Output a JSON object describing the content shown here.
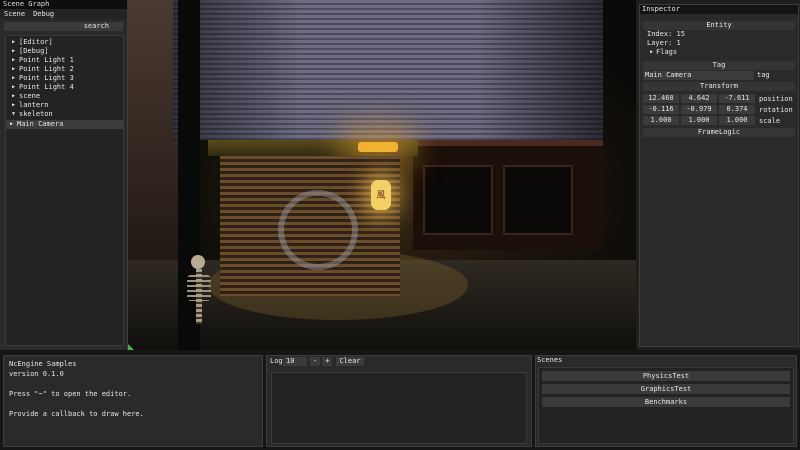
{
  "scene_graph": {
    "title": "Scene Graph",
    "menu": [
      "Scene",
      "Debug"
    ],
    "search_label": "search",
    "items": [
      {
        "label": "[Editor]",
        "expanded": false
      },
      {
        "label": "[Debug]",
        "expanded": false
      },
      {
        "label": "Point Light 1",
        "expanded": false
      },
      {
        "label": "Point Light 2",
        "expanded": false
      },
      {
        "label": "Point Light 3",
        "expanded": false
      },
      {
        "label": "Point Light 4",
        "expanded": false
      },
      {
        "label": "scene",
        "expanded": false
      },
      {
        "label": "lantern",
        "expanded": false
      },
      {
        "label": "skeleton",
        "expanded": true
      },
      {
        "label": "Main Camera",
        "expanded": false,
        "selected": true
      }
    ]
  },
  "viewport": {
    "lantern_glyph": "風"
  },
  "inspector": {
    "title": "Inspector",
    "entity_header": "Entity",
    "index_line": "Index: 15",
    "layer_line": "Layer: 1",
    "flags_label": "Flags",
    "tag_header": "Tag",
    "tag_value": "Main Camera",
    "tag_label": "tag",
    "transform_header": "Transform",
    "position": {
      "values": [
        "12.460",
        "4.642",
        "-7.611"
      ],
      "label": "position"
    },
    "rotation": {
      "values": [
        "-0.116",
        "-0.979",
        "0.374"
      ],
      "label": "rotation"
    },
    "scale": {
      "values": [
        "1.000",
        "1.000",
        "1.000"
      ],
      "label": "scale"
    },
    "framelogic_header": "FrameLogic"
  },
  "info": {
    "line1": "NcEngine Samples",
    "line2": "version 0.1.0",
    "line3": "Press \"~\" to open the editor.",
    "line4": "Provide a callback to draw here."
  },
  "log": {
    "label": "Log",
    "count": "10",
    "minus": "-",
    "plus": "+",
    "clear": "Clear"
  },
  "scenes": {
    "title": "Scenes",
    "buttons": [
      "PhysicsTest",
      "GraphicsTest",
      "Benchmarks"
    ]
  },
  "colors": {
    "panel_bg": "#2a2a2a",
    "title_bar": "#0e0e0e",
    "lantern": "#f3cf68"
  }
}
